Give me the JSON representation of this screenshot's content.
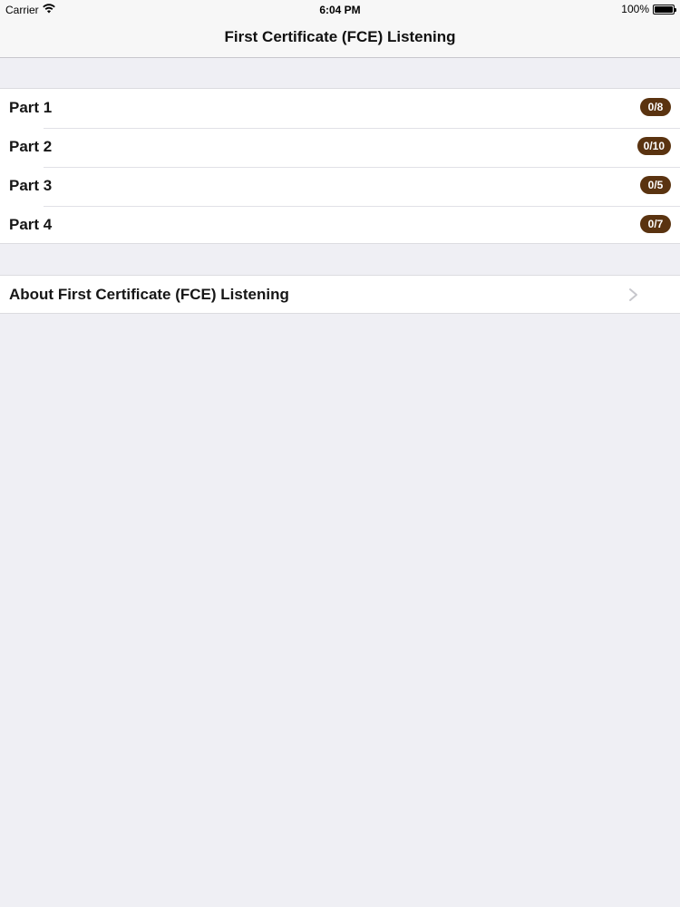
{
  "status_bar": {
    "carrier": "Carrier",
    "time": "6:04 PM",
    "battery_percent": "100%"
  },
  "nav": {
    "title": "First Certificate (FCE) Listening"
  },
  "parts": [
    {
      "label": "Part 1",
      "progress": "0/8"
    },
    {
      "label": "Part 2",
      "progress": "0/10"
    },
    {
      "label": "Part 3",
      "progress": "0/5"
    },
    {
      "label": "Part 4",
      "progress": "0/7"
    }
  ],
  "about": {
    "label": "About First Certificate (FCE) Listening",
    "icon": "chevron-right-icon"
  },
  "colors": {
    "badge": "#5a3310",
    "background": "#efeff4",
    "nav_background": "#f7f7f7"
  }
}
